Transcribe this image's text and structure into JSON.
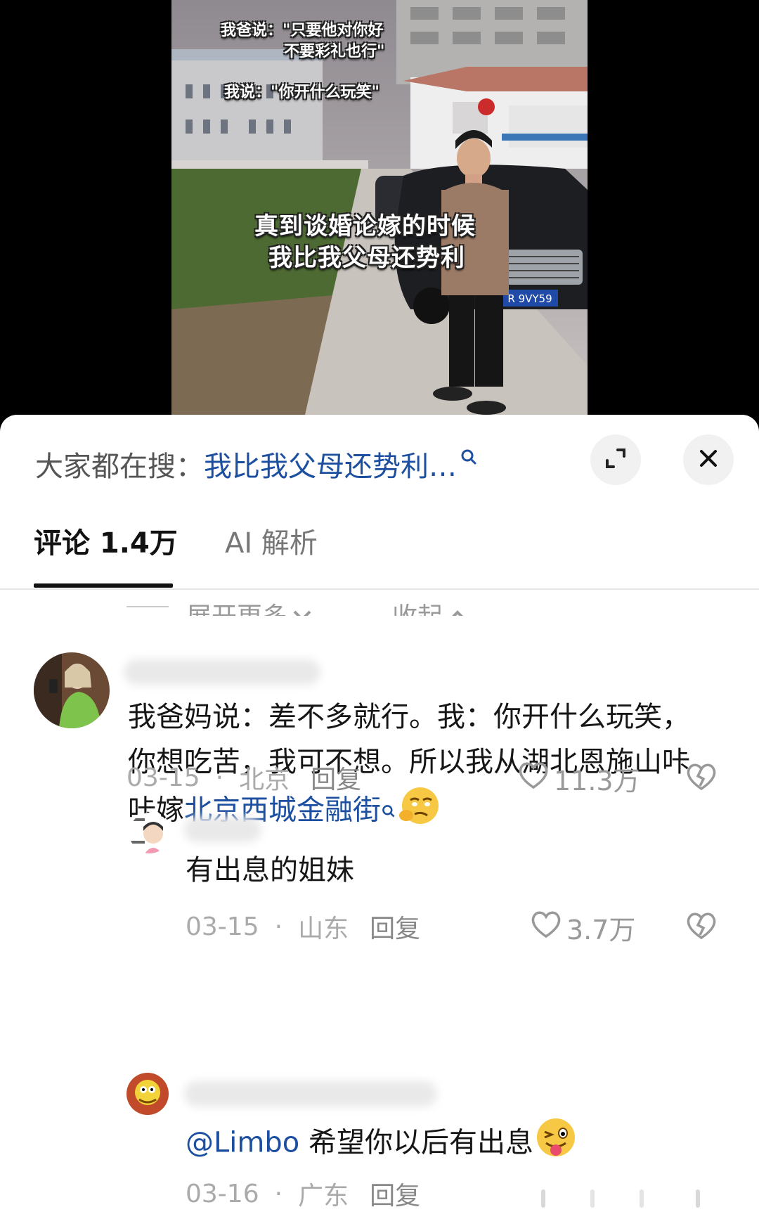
{
  "video": {
    "caption_line1": "我爸说：\"只要他对你好",
    "caption_line2": "不要彩礼也行\"",
    "caption_line3": "我说：\"你开什么玩笑\"",
    "headline_line1": "真到谈婚论嫁的时候",
    "headline_line2": "我比我父母还势利",
    "plate": "R 9VY59"
  },
  "search": {
    "prefix": "大家都在搜：",
    "query": "我比我父母还势利…"
  },
  "tabs": {
    "comments": "评论 1.4万",
    "ai": "AI 解析"
  },
  "fold": {
    "show_more": "展开更多",
    "collapse": "收起"
  },
  "comments": [
    {
      "text_before": "我爸妈说：差不多就行。我：你开什么玩笑，你想吃苦，我可不想。所以我从湖北恩施山咔咔嫁",
      "link": "北京西城金融街",
      "date": "03-15",
      "location": "北京",
      "reply": "回复",
      "likes": "11.3万"
    },
    {
      "text": "有出息的姐妹",
      "date": "03-15",
      "location": "山东",
      "reply": "回复",
      "likes": "3.7万"
    },
    {
      "mention": "@Limbo",
      "text": " 希望你以后有出息",
      "date": "03-16",
      "location": "广东",
      "reply": "回复"
    }
  ],
  "colors": {
    "link_blue": "#1d4fa0",
    "meta_gray": "#aaaaaa",
    "sheet_bg": "#ffffff"
  },
  "icons": [
    "search-icon",
    "expand-icon",
    "close-icon",
    "chevron-down-icon",
    "chevron-up-icon",
    "heart-icon",
    "broken-heart-icon"
  ]
}
